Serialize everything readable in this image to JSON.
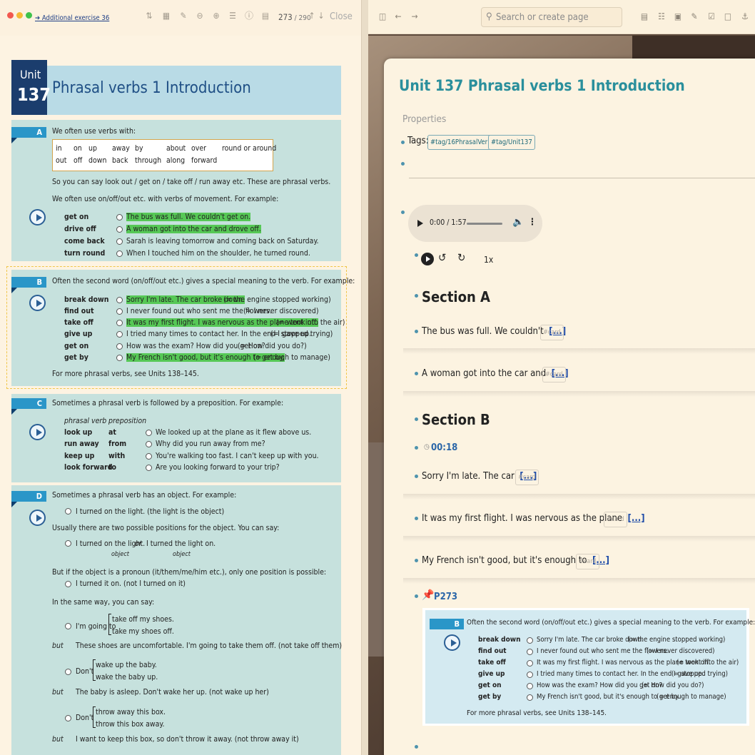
{
  "left": {
    "breadcrumb": "➔ Additional exercise 36",
    "page": {
      "current": "273",
      "separator": " / ",
      "total": "290"
    },
    "close_label": "Close",
    "unit": {
      "word": "Unit",
      "number": "137",
      "title": "Phrasal verbs 1    Introduction"
    },
    "sections": {
      "A": {
        "tab": "A",
        "intro": "We often use verbs with:",
        "words_row1": [
          "in",
          "on",
          "up",
          "away",
          "by",
          "about",
          "over",
          "round or around"
        ],
        "words_row2": [
          "out",
          "off",
          "down",
          "back",
          "through",
          "along",
          "forward"
        ],
        "line1": "So you can say look out / get on / take off / run away etc.  These are phrasal verbs.",
        "line2": "We often use on/off/out etc. with verbs of movement.  For example:",
        "verbs": [
          "get on",
          "drive off",
          "come back",
          "turn round"
        ],
        "examples": [
          "The bus was full.  We couldn't get on.",
          "A woman got into the car and drove off.",
          "Sarah is leaving tomorrow and coming back on Saturday.",
          "When I touched him on the shoulder, he turned round."
        ]
      },
      "B": {
        "tab": "B",
        "intro": "Often the second word (on/off/out etc.) gives a special meaning to the verb.  For example:",
        "verbs": [
          "break down",
          "find out",
          "take off",
          "give up",
          "get on",
          "get by"
        ],
        "examples": [
          "Sorry I'm late.  The car broke down.",
          "I never found out who sent me the flowers.",
          "It was my first flight.  I was nervous as the plane took off.",
          "I tried many times to contact her.  In the end I gave up.",
          "How was the exam?  How did you get on?",
          "My French isn't good, but it's enough to get by."
        ],
        "glosses": [
          "(= the engine stopped working)",
          "(= I never discovered)",
          "(= went into the air)",
          "(= stopped trying)",
          "(= How did you do?)",
          "(= enough to manage)"
        ],
        "more": "For more phrasal verbs, see Units 138–145."
      },
      "C": {
        "tab": "C",
        "intro": "Sometimes a phrasal verb is followed by a preposition.  For example:",
        "col1": "phrasal verb",
        "col2": "preposition",
        "verbs": [
          "look up",
          "run away",
          "keep up",
          "look forward"
        ],
        "preps": [
          "at",
          "from",
          "with",
          "to"
        ],
        "examples": [
          "We looked up at the plane as it flew above us.",
          "Why did you run away from me?",
          "You're walking too fast.  I can't keep up with you.",
          "Are you looking forward to your trip?"
        ]
      },
      "D": {
        "tab": "D",
        "intro": "Sometimes a phrasal verb has an object.  For example:",
        "ex1": "I turned on the light.  (the light is the object)",
        "line2": "Usually there are two possible positions for the object.  You can say:",
        "ex2a": "I turned on the light.",
        "or": "or",
        "ex2b": "I turned the light on.",
        "object": "object",
        "line3": "But if the object is a pronoun (it/them/me/him etc.), only one position is possible:",
        "ex3": "I turned it on.  (not I turned on it)",
        "line4": "In the same way, you can say:",
        "going_to": "I'm going to",
        "shoes_a": "take off my shoes.",
        "shoes_b": "take my shoes off.",
        "but": "but",
        "shoes_but": "These shoes are uncomfortable.  I'm going to take them off.  (not take off them)",
        "dont": "Don't",
        "baby_a": "wake up the baby.",
        "baby_b": "wake the baby up.",
        "baby_but": "The baby is asleep.  Don't wake her up.  (not wake up her)",
        "box_a": "throw away this box.",
        "box_b": "throw this box away.",
        "box_but": "I want to keep this box, so don't throw it away.  (not throw away it)"
      }
    }
  },
  "right": {
    "search_placeholder": "Search or create page",
    "page_title": "Unit 137 Phrasal verbs 1 Introduction",
    "properties_label": "Properties",
    "tags_label": "Tags:",
    "tags": [
      "#tag/16PhrasalVerbs",
      "#tag/Unit137"
    ],
    "audio_time": "0:00 / 1:57",
    "speed": "1x",
    "section_a": "Section A",
    "section_b": "Section B",
    "timestamp": "00:18",
    "cloze_mark": "[...]",
    "card_tag": "#card",
    "cards_a": [
      "The bus was full. We couldn't",
      "A woman got into the car and"
    ],
    "cards_b": [
      "Sorry I'm late. The car",
      "It was my first flight. I was nervous as the plane",
      "My French isn't good, but it's enough to"
    ],
    "pin_label": "P273"
  },
  "colors": {
    "accent": "#2a8f9c",
    "unit_box": "#1b3d6d",
    "section_tab": "#2a96c8",
    "highlight": "#56c856"
  }
}
